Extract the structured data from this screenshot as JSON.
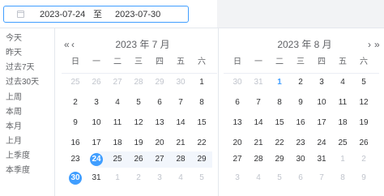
{
  "input": {
    "start": "2023-07-24",
    "separator": "至",
    "end": "2023-07-30"
  },
  "shortcuts": [
    "今天",
    "昨天",
    "过去7天",
    "过去30天",
    "上周",
    "本周",
    "本月",
    "上月",
    "上季度",
    "本季度"
  ],
  "weekdays": [
    "日",
    "一",
    "二",
    "三",
    "四",
    "五",
    "六"
  ],
  "left_panel": {
    "title": "2023 年 7 月",
    "prev_year": "«",
    "prev_month": "‹",
    "weeks": [
      [
        [
          "25",
          "o"
        ],
        [
          "26",
          "o"
        ],
        [
          "27",
          "o"
        ],
        [
          "28",
          "o"
        ],
        [
          "29",
          "o"
        ],
        [
          "30",
          "o"
        ],
        [
          "1",
          ""
        ]
      ],
      [
        [
          "2",
          ""
        ],
        [
          "3",
          ""
        ],
        [
          "4",
          ""
        ],
        [
          "5",
          ""
        ],
        [
          "6",
          ""
        ],
        [
          "7",
          ""
        ],
        [
          "8",
          ""
        ]
      ],
      [
        [
          "9",
          ""
        ],
        [
          "10",
          ""
        ],
        [
          "11",
          ""
        ],
        [
          "12",
          ""
        ],
        [
          "13",
          ""
        ],
        [
          "14",
          ""
        ],
        [
          "15",
          ""
        ]
      ],
      [
        [
          "16",
          ""
        ],
        [
          "17",
          ""
        ],
        [
          "18",
          ""
        ],
        [
          "19",
          ""
        ],
        [
          "20",
          ""
        ],
        [
          "21",
          ""
        ],
        [
          "22",
          ""
        ]
      ],
      [
        [
          "23",
          ""
        ],
        [
          "24",
          "s"
        ],
        [
          "25",
          "r"
        ],
        [
          "26",
          "r"
        ],
        [
          "27",
          "r"
        ],
        [
          "28",
          "r"
        ],
        [
          "29",
          "r"
        ]
      ],
      [
        [
          "30",
          "s"
        ],
        [
          "31",
          ""
        ],
        [
          "1",
          "o"
        ],
        [
          "2",
          "o"
        ],
        [
          "3",
          "o"
        ],
        [
          "4",
          "o"
        ],
        [
          "5",
          "o"
        ]
      ]
    ]
  },
  "right_panel": {
    "title": "2023 年 8 月",
    "next_month": "›",
    "next_year": "»",
    "weeks": [
      [
        [
          "30",
          "o"
        ],
        [
          "31",
          "o"
        ],
        [
          "1",
          "t"
        ],
        [
          "2",
          ""
        ],
        [
          "3",
          ""
        ],
        [
          "4",
          ""
        ],
        [
          "5",
          ""
        ]
      ],
      [
        [
          "6",
          ""
        ],
        [
          "7",
          ""
        ],
        [
          "8",
          ""
        ],
        [
          "9",
          ""
        ],
        [
          "10",
          ""
        ],
        [
          "11",
          ""
        ],
        [
          "12",
          ""
        ]
      ],
      [
        [
          "13",
          ""
        ],
        [
          "14",
          ""
        ],
        [
          "15",
          ""
        ],
        [
          "16",
          ""
        ],
        [
          "17",
          ""
        ],
        [
          "18",
          ""
        ],
        [
          "19",
          ""
        ]
      ],
      [
        [
          "20",
          ""
        ],
        [
          "21",
          ""
        ],
        [
          "22",
          ""
        ],
        [
          "23",
          ""
        ],
        [
          "24",
          ""
        ],
        [
          "25",
          ""
        ],
        [
          "26",
          ""
        ]
      ],
      [
        [
          "27",
          ""
        ],
        [
          "28",
          ""
        ],
        [
          "29",
          ""
        ],
        [
          "30",
          ""
        ],
        [
          "31",
          ""
        ],
        [
          "1",
          "o"
        ],
        [
          "2",
          "o"
        ]
      ],
      [
        [
          "3",
          "o"
        ],
        [
          "4",
          "o"
        ],
        [
          "5",
          "o"
        ],
        [
          "6",
          "o"
        ],
        [
          "7",
          "o"
        ],
        [
          "8",
          "o"
        ],
        [
          "9",
          "o"
        ]
      ]
    ]
  },
  "colors": {
    "accent": "#409eff",
    "range_bg": "#f2f6fc",
    "muted": "#c0c4cc",
    "text": "#303133"
  }
}
